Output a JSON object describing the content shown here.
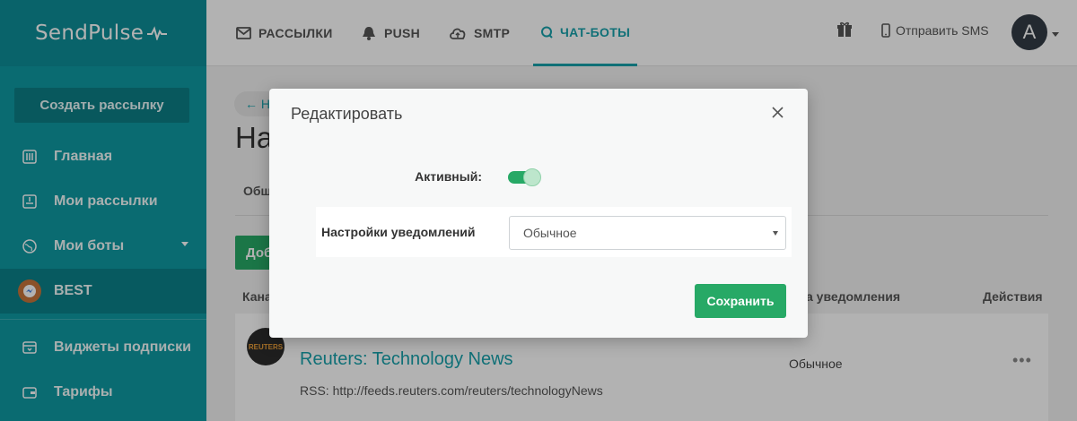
{
  "brand": {
    "name": "SendPulse"
  },
  "sidebar": {
    "create_button": "Создать рассылку",
    "items": [
      {
        "label": "Главная",
        "icon": "dashboard-icon"
      },
      {
        "label": "Мои рассылки",
        "icon": "inbox-icon"
      },
      {
        "label": "Мои боты",
        "icon": "globe-icon"
      },
      {
        "label": "BEST",
        "icon": "messenger-icon"
      },
      {
        "label": "Виджеты подписки",
        "icon": "widget-icon"
      },
      {
        "label": "Тарифы",
        "icon": "wallet-icon"
      }
    ]
  },
  "topbar": {
    "tabs": [
      {
        "label": "РАССЫЛКИ",
        "icon": "mail-icon"
      },
      {
        "label": "PUSH",
        "icon": "bell-icon"
      },
      {
        "label": "SMTP",
        "icon": "cloud-upload-icon"
      },
      {
        "label": "ЧАТ-БОТЫ",
        "icon": "chat-icon",
        "active": true
      }
    ],
    "sms_label": "Отправить SMS",
    "avatar_letter": "A"
  },
  "page": {
    "back_label": "← На",
    "title": "На",
    "sub_tab": "Общ",
    "add_button": "Доб",
    "table_headers": {
      "channel": "Кана",
      "notification": "а уведомления",
      "actions": "Действия"
    },
    "row": {
      "logo_text": "REUTERS",
      "title": "Reuters: Technology News",
      "url": "RSS: http://feeds.reuters.com/reuters/technologyNews",
      "mode": "Обычное",
      "actions": "•••"
    }
  },
  "modal": {
    "title": "Редактировать",
    "active_label": "Активный:",
    "active_on": true,
    "notification_label": "Настройки уведомлений",
    "notification_value": "Обычное",
    "save_button": "Сохранить"
  },
  "colors": {
    "teal": "#0f9aa3",
    "accent": "#17a1ab",
    "green": "#27a966"
  }
}
